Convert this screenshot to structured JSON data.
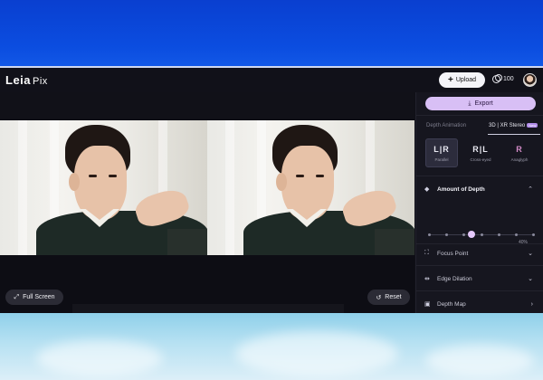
{
  "header": {
    "logo_main": "Leia",
    "logo_sub": "Pix",
    "upload_label": "Upload",
    "credits_count": "100"
  },
  "canvas": {
    "fullscreen_label": "Full Screen",
    "reset_label": "Reset"
  },
  "panel": {
    "export_label": "Export",
    "tabs": [
      {
        "label": "Depth Animation",
        "active": false
      },
      {
        "label": "3D | XR Stereo",
        "active": true,
        "badge": "New"
      }
    ],
    "modes": [
      {
        "glyph": "L|R",
        "label": "Parallel",
        "selected": true
      },
      {
        "glyph": "R|L",
        "label": "Cross-eyed",
        "selected": false
      },
      {
        "glyph": "R",
        "label": "Anaglyph",
        "selected": false
      }
    ],
    "sections": [
      {
        "title": "Amount of Depth",
        "icon": "cube-icon",
        "expanded": true
      },
      {
        "title": "Focus Point",
        "icon": "focus-icon",
        "expanded": false
      },
      {
        "title": "Edge Dilation",
        "icon": "dilation-icon",
        "expanded": false
      },
      {
        "title": "Depth Map",
        "icon": "layers-icon",
        "expanded": false
      }
    ],
    "depth_slider": {
      "value_label": "40%",
      "position_fraction": 0.4,
      "ticks": 7
    }
  },
  "colors": {
    "accent": "#d8bff5",
    "app_background": "#0f0f17",
    "desktop_top": "#0b49d8"
  }
}
